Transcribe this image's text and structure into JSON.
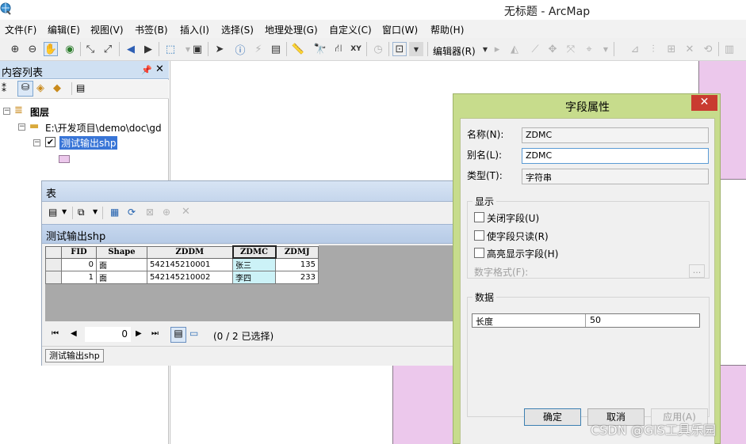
{
  "app": {
    "title": "无标题 - ArcMap",
    "icon": "arcmap-globe-icon"
  },
  "menubar": {
    "items": [
      "文件(F)",
      "编辑(E)",
      "视图(V)",
      "书签(B)",
      "插入(I)",
      "选择(S)",
      "地理处理(G)",
      "自定义(C)",
      "窗口(W)",
      "帮助(H)"
    ]
  },
  "toolbar": {
    "editor_label": "编辑器(R)",
    "icons": [
      "zoom-in-icon",
      "zoom-out-icon",
      "pan-hand-icon",
      "full-extent-globe-icon",
      "fixed-zoom-in-icon",
      "fixed-zoom-out-icon",
      "back-arrow-icon",
      "forward-arrow-icon",
      "select-features-icon",
      "clear-selection-icon",
      "select-elements-icon",
      "identify-icon",
      "hyperlink-icon",
      "html-popup-icon",
      "measure-icon",
      "find-icon",
      "route-icon",
      "go-to-xy-icon",
      "time-slider-icon",
      "data-view-icon"
    ]
  },
  "toc": {
    "title": "内容列表",
    "pin_icon": "pin-icon",
    "close_icon": "close-icon",
    "root_label": "图层",
    "folder_label": "E:\\开发项目\\demo\\doc\\gd",
    "layer_label": "测试输出shp",
    "layer_checked": true,
    "legend_color": "#ecc8ec"
  },
  "table_window": {
    "title": "表",
    "tab_title": "测试输出shp",
    "columns": [
      "FID",
      "Shape",
      "ZDDM",
      "ZDMC",
      "ZDMJ"
    ],
    "rows": [
      [
        "0",
        "面",
        "542145210001",
        "张三",
        "135"
      ],
      [
        "1",
        "面",
        "542145210002",
        "李四",
        "233"
      ]
    ],
    "selected_column": "ZDMC",
    "nav_record": "0",
    "selection_status": "(0 / 2 已选择)",
    "bottom_tab": "测试输出shp"
  },
  "field_dialog": {
    "title": "字段属性",
    "name_label": "名称(N):",
    "name_value": "ZDMC",
    "alias_label": "别名(L):",
    "alias_value": "ZDMC",
    "type_label": "类型(T):",
    "type_value": "字符串",
    "display_group": "显示",
    "checkboxes": [
      "关闭字段(U)",
      "使字段只读(R)",
      "高亮显示字段(H)"
    ],
    "number_format_label": "数字格式(F):",
    "ellipsis_label": "...",
    "data_group": "数据",
    "length_label": "长度",
    "length_value": "50",
    "ok_label": "确定",
    "cancel_label": "取消",
    "apply_label": "应用(A)"
  },
  "watermark": "CSDN @GIS工具乐园",
  "colors": {
    "polygon_fill": "#ecc8ec",
    "dialog_frame": "#c7dc8c",
    "close_red": "#c93b30",
    "selection_blue": "#3875d7",
    "selected_cell": "#ccf2f7"
  }
}
